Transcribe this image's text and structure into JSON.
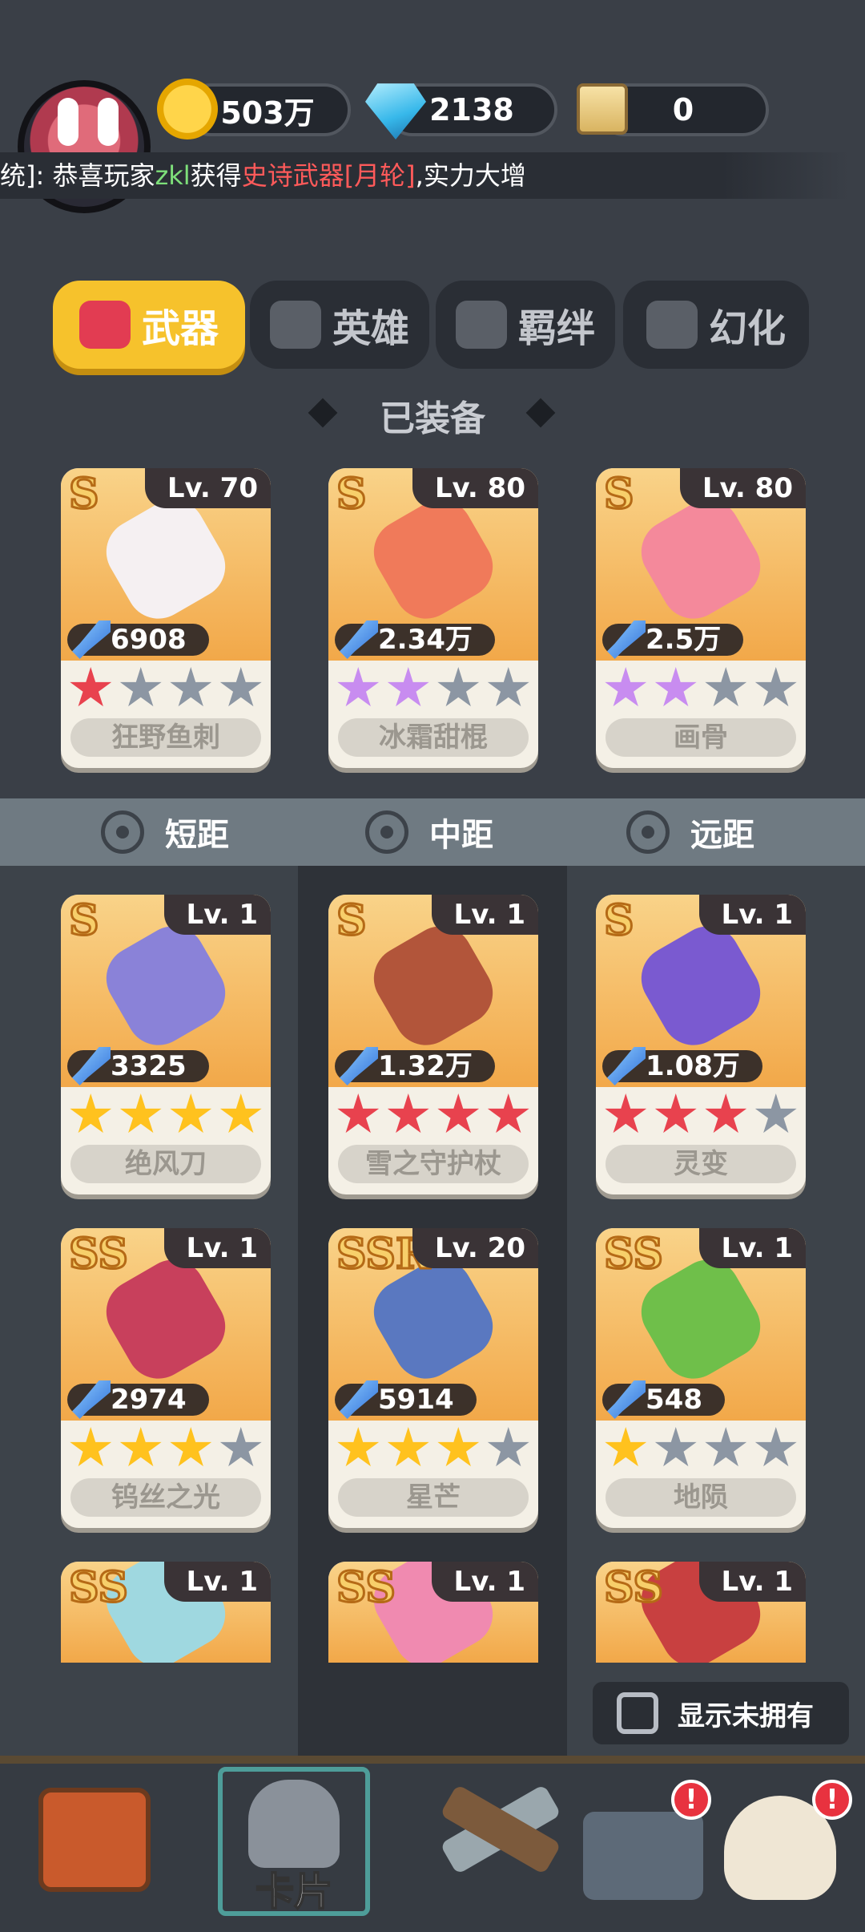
{
  "header": {
    "coins": "503万",
    "gems": "2138",
    "scrolls": "0"
  },
  "marquee": {
    "prefix": "统]: 恭喜玩家",
    "player": "zkl",
    "action": "获得",
    "item": "史诗武器[月轮]",
    "suffix": ",实力大增"
  },
  "tabs": [
    {
      "label": "武器",
      "icon": "weapon-tab-icon",
      "active": true
    },
    {
      "label": "英雄",
      "icon": "hero-tab-icon",
      "active": false
    },
    {
      "label": "羁绊",
      "icon": "bond-tab-icon",
      "active": false
    },
    {
      "label": "幻化",
      "icon": "transform-tab-icon",
      "active": false
    }
  ],
  "equipped": {
    "title": "已装备",
    "cards": [
      {
        "rank": "S",
        "level": "Lv. 70",
        "power": "6908",
        "name": "狂野鱼刺",
        "stars": 1,
        "star_color": "red",
        "weapon_color": "#f5f0f2"
      },
      {
        "rank": "S",
        "level": "Lv. 80",
        "power": "2.34万",
        "name": "冰霜甜棍",
        "stars": 2,
        "star_color": "purple",
        "weapon_color": "#f07a5a"
      },
      {
        "rank": "S",
        "level": "Lv. 80",
        "power": "2.5万",
        "name": "画骨",
        "stars": 2,
        "star_color": "purple",
        "weapon_color": "#f4899b"
      }
    ]
  },
  "distance_tabs": [
    {
      "label": "短距",
      "icon": "short-range-icon"
    },
    {
      "label": "中距",
      "icon": "mid-range-icon"
    },
    {
      "label": "远距",
      "icon": "long-range-icon"
    }
  ],
  "weapons": [
    {
      "rank": "S",
      "level": "Lv. 1",
      "power": "3325",
      "name": "绝风刀",
      "stars": 4,
      "star_color": "gold",
      "weapon_color": "#8a82d8"
    },
    {
      "rank": "S",
      "level": "Lv. 1",
      "power": "1.32万",
      "name": "雪之守护杖",
      "stars": 4,
      "star_color": "red",
      "weapon_color": "#b2553a"
    },
    {
      "rank": "S",
      "level": "Lv. 1",
      "power": "1.08万",
      "name": "灵变",
      "stars": 3,
      "star_color": "red",
      "weapon_color": "#7a5ad0"
    },
    {
      "rank": "SS",
      "level": "Lv. 1",
      "power": "2974",
      "name": "钨丝之光",
      "stars": 3,
      "star_color": "gold",
      "weapon_color": "#c8405c"
    },
    {
      "rank": "SSR",
      "level": "Lv. 20",
      "power": "5914",
      "name": "星芒",
      "stars": 3,
      "star_color": "gold",
      "weapon_color": "#5a78c0"
    },
    {
      "rank": "SS",
      "level": "Lv. 1",
      "power": "548",
      "name": "地陨",
      "stars": 1,
      "star_color": "gold",
      "weapon_color": "#6fbf4a"
    },
    {
      "rank": "SS",
      "level": "Lv. 1",
      "weapon_color": "#9fd8e0"
    },
    {
      "rank": "SS",
      "level": "Lv. 1",
      "weapon_color": "#f08ab0"
    },
    {
      "rank": "SS",
      "level": "Lv. 1",
      "weapon_color": "#c84040"
    }
  ],
  "show_unowned": "显示未拥有",
  "bottom_nav": [
    {
      "name": "shop",
      "icon": "shop-icon",
      "label": "",
      "badge": false
    },
    {
      "name": "cards",
      "icon": "knight-helmet-icon",
      "label": "卡片",
      "badge": false,
      "active": true
    },
    {
      "name": "battle",
      "icon": "crossed-guns-icon",
      "label": "",
      "badge": false
    },
    {
      "name": "treasure",
      "icon": "treasure-chest-icon",
      "label": "",
      "badge": true,
      "badge_text": "!"
    },
    {
      "name": "boss",
      "icon": "skull-icon",
      "label": "",
      "badge": true,
      "badge_text": "!"
    }
  ],
  "colors": {
    "active_tab": "#f6c22c",
    "background": "#3a3f47",
    "star_red": "#e8424e",
    "star_gold": "#ffc21e",
    "star_purple": "#c88cf0"
  }
}
